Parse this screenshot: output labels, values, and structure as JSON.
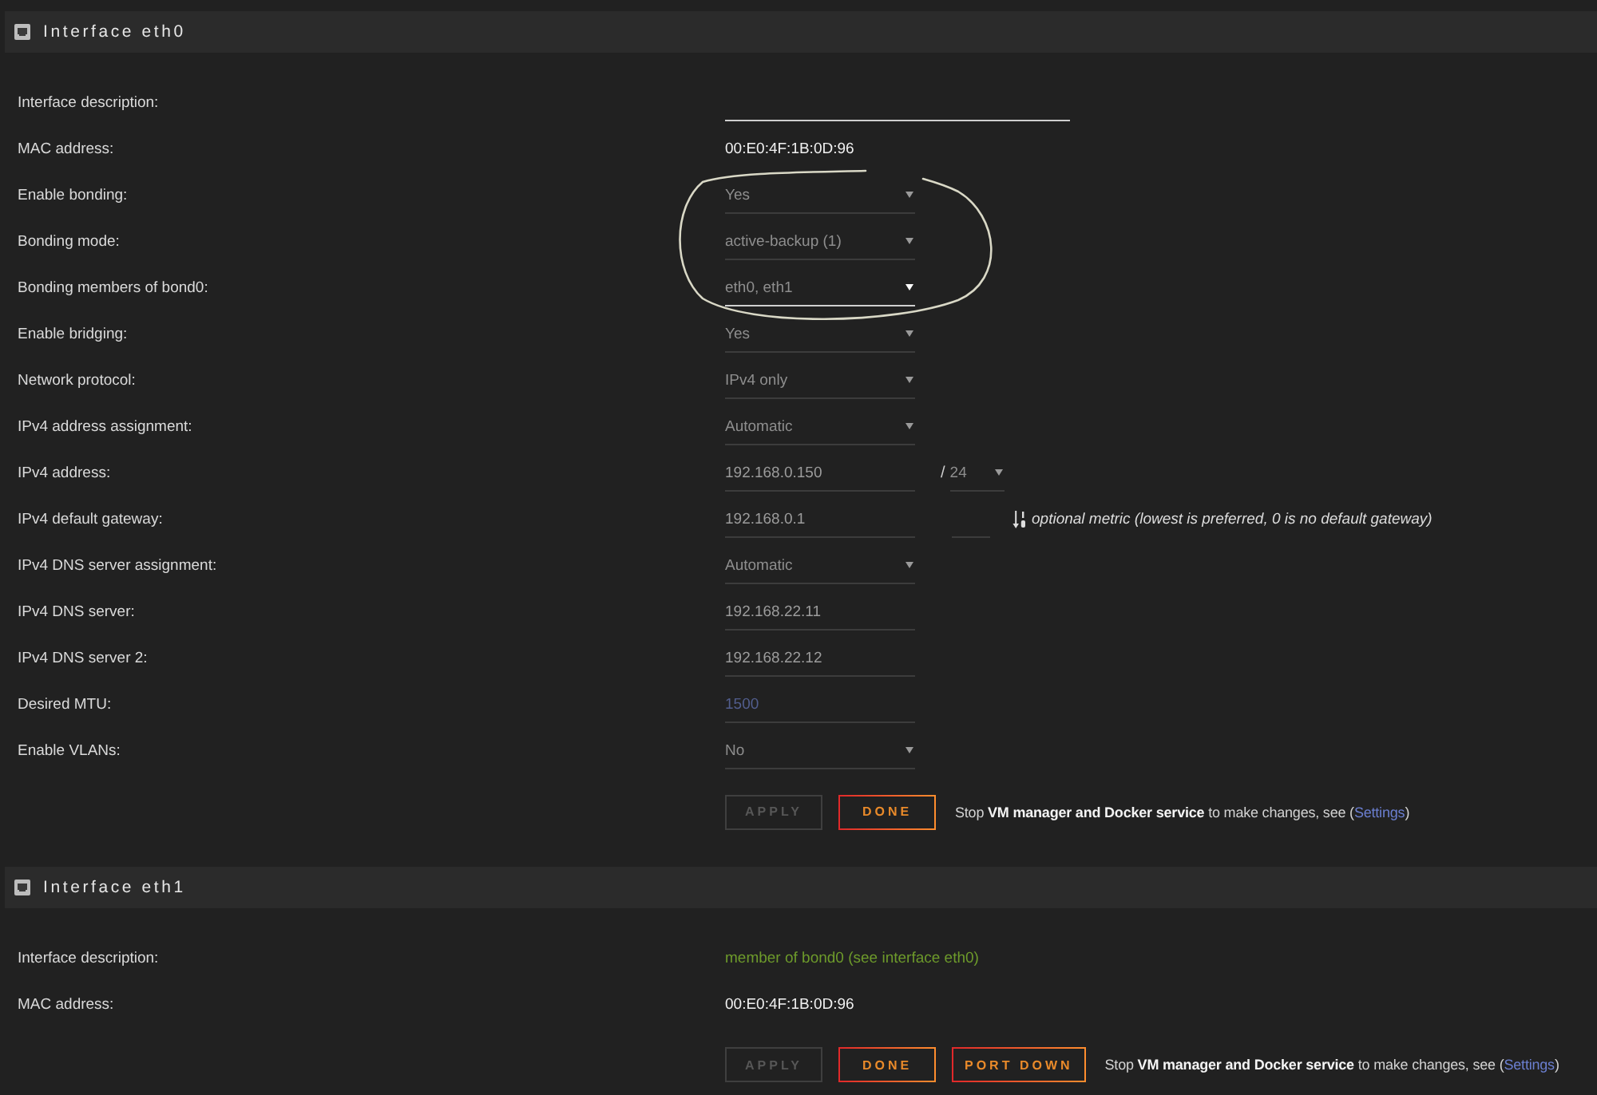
{
  "sections": [
    {
      "title": "Interface eth0",
      "rows": [
        {
          "label": "Interface description:",
          "kind": "description",
          "focused": true
        },
        {
          "label": "MAC address:",
          "kind": "value",
          "value": "00:E0:4F:1B:0D:96"
        },
        {
          "label": "Enable bonding:",
          "kind": "select",
          "value": "Yes",
          "focused": false
        },
        {
          "label": "Bonding mode:",
          "kind": "select",
          "value": "active-backup (1)",
          "focused": false
        },
        {
          "label": "Bonding members of bond0:",
          "kind": "select",
          "value": "eth0, eth1",
          "focused": true
        },
        {
          "label": "Enable bridging:",
          "kind": "select",
          "value": "Yes",
          "focused": false
        },
        {
          "label": "Network protocol:",
          "kind": "select",
          "value": "IPv4 only",
          "focused": false
        },
        {
          "label": "IPv4 address assignment:",
          "kind": "select",
          "value": "Automatic",
          "focused": false
        },
        {
          "label": "IPv4 address:",
          "kind": "input",
          "value": "192.168.0.150",
          "focused": false,
          "suffix": {
            "kind": "prefix",
            "separator": "/",
            "value": "24"
          }
        },
        {
          "label": "IPv4 default gateway:",
          "kind": "input",
          "value": "192.168.0.1",
          "focused": false,
          "suffix": {
            "kind": "metric",
            "hint": "optional metric (lowest is preferred, 0 is no default gateway)"
          }
        },
        {
          "label": "IPv4 DNS server assignment:",
          "kind": "select",
          "value": "Automatic",
          "focused": false
        },
        {
          "label": "IPv4 DNS server:",
          "kind": "input",
          "value": "192.168.22.11",
          "focused": false
        },
        {
          "label": "IPv4 DNS server 2:",
          "kind": "input",
          "value": "192.168.22.12",
          "focused": false
        },
        {
          "label": "Desired MTU:",
          "kind": "input",
          "placeholder": "1500",
          "focused": false
        },
        {
          "label": "Enable VLANs:",
          "kind": "select",
          "value": "No",
          "focused": false
        }
      ],
      "buttons": [
        {
          "label": "APPLY",
          "disabled": true
        },
        {
          "label": "DONE",
          "disabled": false
        }
      ],
      "notice": {
        "text": "Stop **VM manager and Docker service** to make changes, see (",
        "link": "Settings",
        "after": ")"
      }
    },
    {
      "title": "Interface eth1",
      "rows": [
        {
          "label": "Interface description:",
          "kind": "note",
          "value": "member of bond0 (see interface eth0)"
        },
        {
          "label": "MAC address:",
          "kind": "value",
          "value": "00:E0:4F:1B:0D:96"
        }
      ],
      "buttons": [
        {
          "label": "APPLY",
          "disabled": true
        },
        {
          "label": "DONE",
          "disabled": false
        },
        {
          "label": "PORT DOWN",
          "disabled": false
        }
      ],
      "notice": {
        "text": "Stop **VM manager and Docker service** to make changes, see (",
        "link": "Settings",
        "after": ")"
      }
    }
  ]
}
